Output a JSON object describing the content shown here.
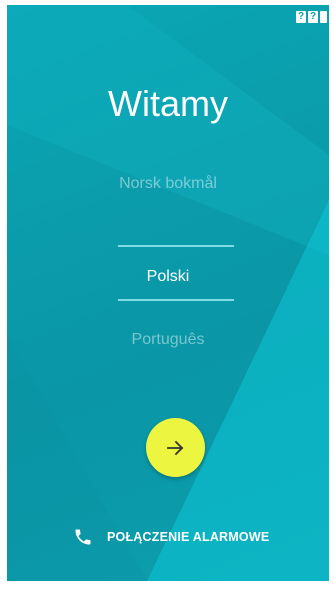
{
  "status_bar": {
    "icons": [
      "unknown-signal-icon",
      "unknown-signal-icon",
      "battery-icon"
    ],
    "sim1_glyph": "?",
    "sim2_glyph": "?"
  },
  "welcome": {
    "title": "Witamy"
  },
  "language_picker": {
    "previous": "Norsk bokmål",
    "selected": "Polski",
    "next": "Português"
  },
  "next_button": {
    "icon": "arrow-right-icon",
    "color": "#ecf540"
  },
  "emergency": {
    "icon": "phone-icon",
    "label": "POŁĄCZENIE ALARMOWE"
  },
  "colors": {
    "background": "#0a9fb0",
    "accent": "#ecf540",
    "divider": "#96e6f0"
  }
}
